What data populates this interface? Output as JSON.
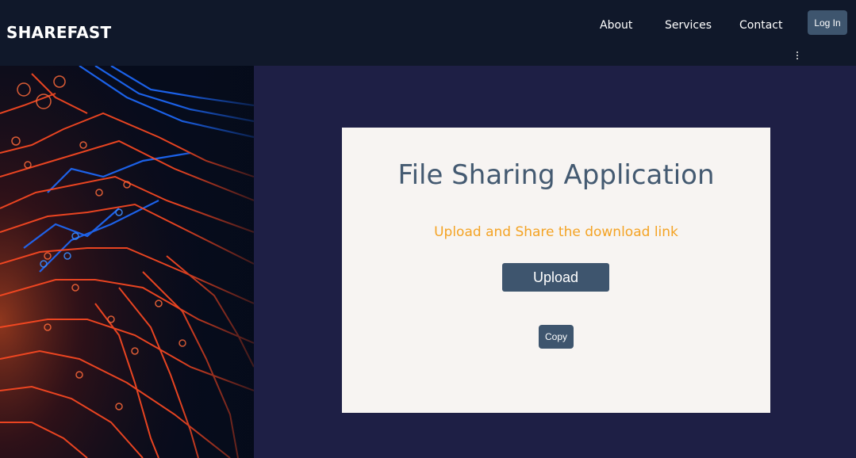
{
  "header": {
    "brand": "SHAREFAST",
    "nav": [
      {
        "label": "About"
      },
      {
        "label": "Services"
      },
      {
        "label": "Contact"
      }
    ],
    "login_label": "Log In"
  },
  "hero": {
    "image": "circuit-board-image"
  },
  "card": {
    "title": "File Sharing Application",
    "subtitle": "Upload and Share the download link",
    "upload_label": "Upload",
    "copy_label": "Copy"
  },
  "colors": {
    "header_bg": "#10182a",
    "page_bg": "#1e1f45",
    "card_bg": "#f7f4f2",
    "button_bg": "#3e556e",
    "title_color": "#445a71",
    "subtitle_color": "#f4a324"
  }
}
